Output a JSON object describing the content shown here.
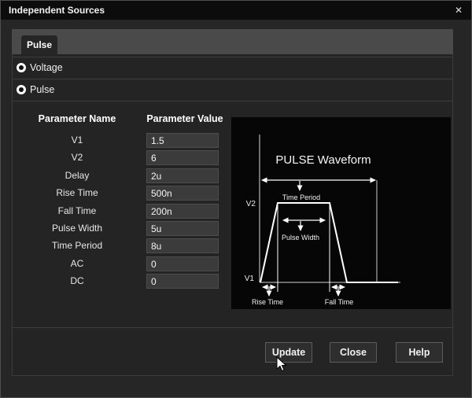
{
  "window": {
    "title": "Independent Sources",
    "close_glyph": "✕"
  },
  "tab": {
    "label": "Pulse"
  },
  "sources": [
    {
      "label": "Voltage",
      "selected": true
    },
    {
      "label": "Pulse",
      "selected": true
    }
  ],
  "table": {
    "headers": [
      "Parameter Name",
      "Parameter Value"
    ],
    "rows": [
      {
        "name": "V1",
        "value": "1.5"
      },
      {
        "name": "V2",
        "value": "6"
      },
      {
        "name": "Delay",
        "value": "2u"
      },
      {
        "name": "Rise Time",
        "value": "500n"
      },
      {
        "name": "Fall Time",
        "value": "200n"
      },
      {
        "name": "Pulse Width",
        "value": "5u"
      },
      {
        "name": "Time Period",
        "value": "8u"
      },
      {
        "name": "AC",
        "value": "0"
      },
      {
        "name": "DC",
        "value": "0"
      }
    ]
  },
  "waveform": {
    "title": "PULSE Waveform",
    "labels": {
      "v1": "V1",
      "v2": "V2",
      "time_period": "Time Period",
      "pulse_width": "Pulse Width",
      "rise_time": "Rise Time",
      "fall_time": "Fall Time"
    }
  },
  "buttons": [
    {
      "label": "Update"
    },
    {
      "label": "Close"
    },
    {
      "label": "Help"
    }
  ],
  "colors": {
    "titlebar": "#0c0c0c",
    "body": "#262626",
    "tabstrip": "#4a4a4a",
    "content": "#242424",
    "input_bg": "#3b3b3b",
    "wave_panel": "#060606",
    "wave_stroke": "#ffffff",
    "axis_stroke": "#a8a8a8"
  }
}
